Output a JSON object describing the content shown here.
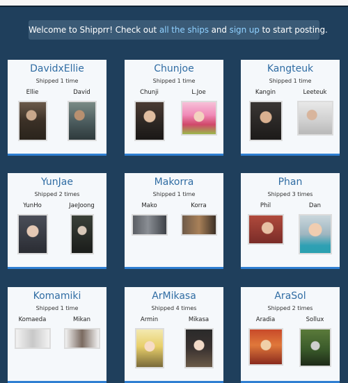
{
  "welcome": {
    "prefix": "Welcome to Shipprr! Check out ",
    "link1": "all the ships",
    "middle": " and ",
    "link2": "sign up",
    "suffix": " to start posting."
  },
  "cards": [
    {
      "title": "DavidxEllie",
      "sub": "Shipped 1 time",
      "a": "Ellie",
      "b": "David"
    },
    {
      "title": "Chunjoe",
      "sub": "Shipped 1 time",
      "a": "Chunji",
      "b": "L.Joe"
    },
    {
      "title": "Kangteuk",
      "sub": "Shipped 1 time",
      "a": "Kangin",
      "b": "Leeteuk"
    },
    {
      "title": "YunJae",
      "sub": "Shipped 2 times",
      "a": "YunHo",
      "b": "JaeJoong"
    },
    {
      "title": "Makorra",
      "sub": "Shipped 1 time",
      "a": "Mako",
      "b": "Korra"
    },
    {
      "title": "Phan",
      "sub": "Shipped 3 times",
      "a": "Phil",
      "b": "Dan"
    },
    {
      "title": "Komamiki",
      "sub": "Shipped 1 time",
      "a": "Komaeda",
      "b": "Mikan"
    },
    {
      "title": "ArMikasa",
      "sub": "Shipped 4 times",
      "a": "Armin",
      "b": "Mikasa"
    },
    {
      "title": "AraSol",
      "sub": "Shipped 2 times",
      "a": "Aradia",
      "b": "Sollux"
    }
  ]
}
